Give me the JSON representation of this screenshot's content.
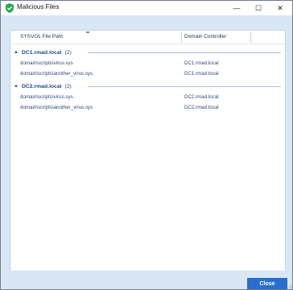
{
  "window": {
    "title": "Malicious Files",
    "icon": "shield-check-icon",
    "controls": {
      "minimize": "—",
      "maximize": "☐",
      "close": "✕"
    }
  },
  "grid": {
    "columns": [
      "SYSVOL File Path",
      "Domain Controller"
    ],
    "groups": [
      {
        "name": "DC1.rmad.local",
        "count": "(2)",
        "rows": [
          {
            "path": "domain\\scripts\\virus.sys",
            "dc": "DC1.rmad.local"
          },
          {
            "path": "domain\\scripts\\another_virus.sys",
            "dc": "DC1.rmad.local"
          }
        ]
      },
      {
        "name": "DC2.rmad.local",
        "count": "(2)",
        "rows": [
          {
            "path": "domain\\scripts\\virus.sys",
            "dc": "DC2.rmad.local"
          },
          {
            "path": "domain\\scripts\\another_virus.sys",
            "dc": "DC2.rmad.local"
          }
        ]
      }
    ]
  },
  "footer": {
    "close_label": "Close"
  },
  "colors": {
    "accent": "#2a6fd0",
    "background": "#d9e7f5",
    "group_text": "#1b4d8c"
  }
}
